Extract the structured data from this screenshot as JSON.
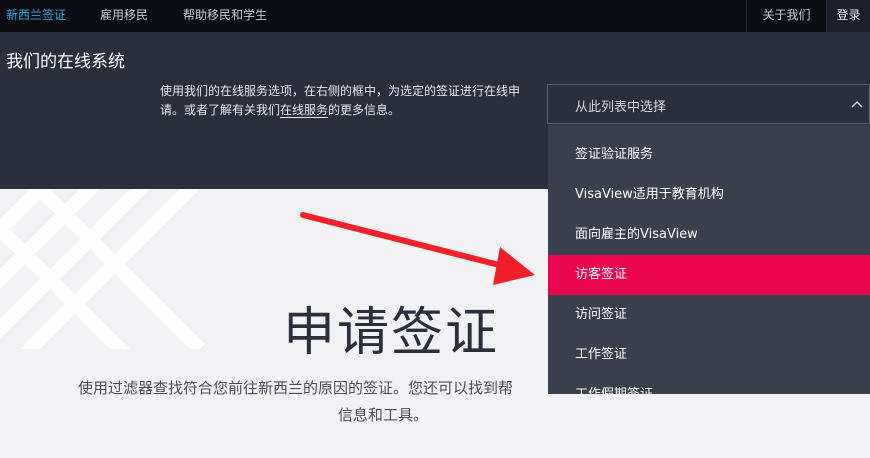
{
  "nav": {
    "items": [
      "新西兰签证",
      "雇用移民",
      "帮助移民和学生"
    ],
    "about": "关于我们",
    "login": "登录"
  },
  "online": {
    "title": "我们的在线系统",
    "desc_part1": "使用我们的在线服务选项，在右侧的框中，为选定的签证进行在线申请。或者了解有关我们",
    "desc_link": "在线服务",
    "desc_part2": "的更多信息。"
  },
  "select": {
    "placeholder": "从此列表中选择",
    "options": [
      "签证验证服务",
      "VisaView适用于教育机构",
      "面向雇主的VisaView",
      "访客签证",
      "访问签证",
      "工作签证",
      "工作假期签证"
    ],
    "highlighted_index": 3
  },
  "main": {
    "title": "申请签证",
    "desc_line1": "使用过滤器查找符合您前往新西兰的原因的签证。您还可以找到帮",
    "desc_line2": "信息和工具。"
  },
  "colors": {
    "accent": "#e9054f",
    "nav_active": "#2fa8e6",
    "dark_band": "#2b2e3b",
    "arrow": "#f0202a"
  }
}
